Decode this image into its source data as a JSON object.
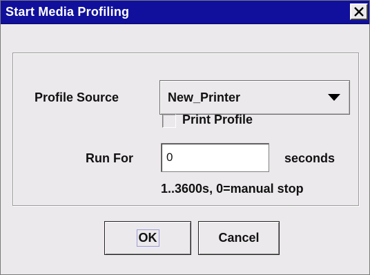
{
  "window": {
    "title": "Start Media Profiling",
    "close_icon": "close-x-icon"
  },
  "form": {
    "profile_source_label": "Profile Source",
    "profile_source_value": "New_Printer",
    "print_profile_label": "Print Profile",
    "print_profile_checked": false,
    "run_for_label": "Run For",
    "run_for_value": "0",
    "seconds_label": "seconds",
    "hint": "1..3600s, 0=manual stop"
  },
  "buttons": {
    "ok_label": "OK",
    "cancel_label": "Cancel"
  },
  "colors": {
    "title_bar": "#10109c",
    "window_bg": "#ece9ec",
    "input_bg": "#ffffff"
  }
}
